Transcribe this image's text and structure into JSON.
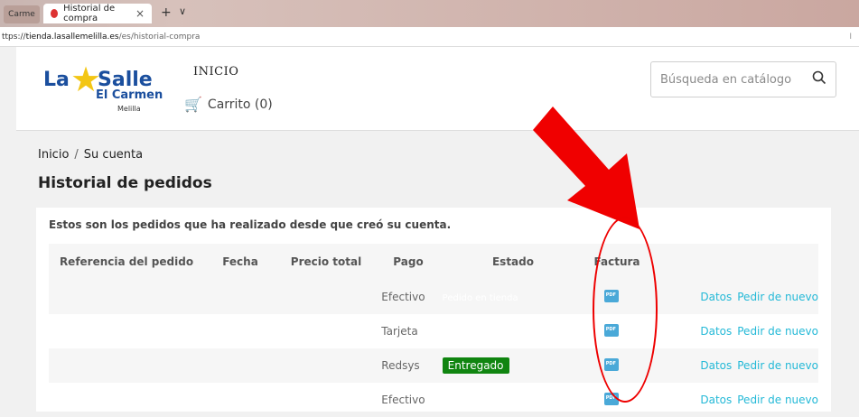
{
  "browser": {
    "prev_tab": "Carme",
    "tab_title": "Historial de compra",
    "tab_close": "×",
    "new_tab": "+",
    "tab_dropdown": "∨",
    "url_prefix": "ttps://",
    "url_domain": "tienda.lasallemelilla.es",
    "url_path": "/es/historial-compra",
    "url_right": "I"
  },
  "header": {
    "logo_la": "La",
    "logo_salle": "Salle",
    "logo_carmen": "El Carmen",
    "logo_melilla": "Melilla",
    "nav_inicio": "INICIO",
    "cart_label": "Carrito (0)",
    "search_placeholder": "Búsqueda en catálogo"
  },
  "breadcrumb": {
    "home": "Inicio",
    "sep": "/",
    "current": "Su cuenta"
  },
  "page_title": "Historial de pedidos",
  "intro": "Estos son los pedidos que ha realizado desde que creó su cuenta.",
  "table": {
    "headers": [
      "Referencia del pedido",
      "Fecha",
      "Precio total",
      "Pago",
      "Estado",
      "Factura"
    ],
    "rows": [
      {
        "pago": "Efectivo",
        "estado": "Pedido en tienda",
        "estado_color": "#f6f6f6",
        "datos": "Datos",
        "reorder": "Pedir de nuevo"
      },
      {
        "pago": "Tarjeta",
        "estado": "",
        "estado_color": "",
        "datos": "Datos",
        "reorder": "Pedir de nuevo"
      },
      {
        "pago": "Redsys",
        "estado": "Entregado",
        "estado_color": "#108510",
        "datos": "Datos",
        "reorder": "Pedir de nuevo"
      },
      {
        "pago": "Efectivo",
        "estado": "",
        "estado_color": "",
        "datos": "Datos",
        "reorder": "Pedir de nuevo"
      }
    ]
  },
  "icons": {
    "search": "search-icon",
    "cart": "cart-icon",
    "invoice": "pdf-icon"
  },
  "colors": {
    "link": "#24b9d7",
    "badge_delivered": "#108510",
    "annotation": "#e00000"
  }
}
